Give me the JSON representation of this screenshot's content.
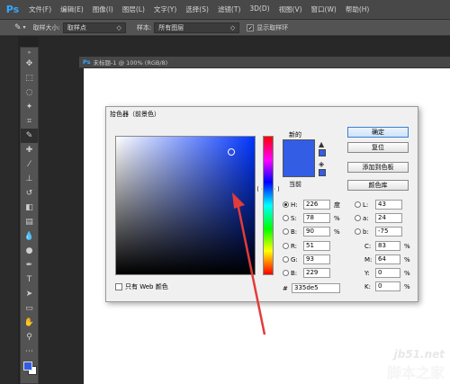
{
  "app": {
    "logo": "Ps"
  },
  "menu": [
    "文件(F)",
    "编辑(E)",
    "图像(I)",
    "图层(L)",
    "文字(Y)",
    "选择(S)",
    "滤镜(T)",
    "3D(D)",
    "视图(V)",
    "窗口(W)",
    "帮助(H)"
  ],
  "options": {
    "sample_size_label": "取样大小:",
    "sample_size_value": "取样点",
    "sample_label": "样本:",
    "sample_value": "所有图层",
    "show_ring_label": "显示取样环"
  },
  "document": {
    "tab_title": "未标题-1 @ 100% (RGB/8)"
  },
  "dialog": {
    "title": "拾色器（前景色）",
    "new_label": "新的",
    "current_label": "当前",
    "ok": "确定",
    "reset": "复位",
    "add_swatch": "添加到色板",
    "color_libraries": "颜色库",
    "web_only": "只有 Web 颜色",
    "hex_label": "#",
    "hex": "335de5",
    "hsb": [
      {
        "label": "H:",
        "value": "226",
        "unit": "度"
      },
      {
        "label": "S:",
        "value": "78",
        "unit": "%"
      },
      {
        "label": "B:",
        "value": "90",
        "unit": "%"
      }
    ],
    "rgb": [
      {
        "label": "R:",
        "value": "51"
      },
      {
        "label": "G:",
        "value": "93"
      },
      {
        "label": "B:",
        "value": "229"
      }
    ],
    "lab": [
      {
        "label": "L:",
        "value": "43"
      },
      {
        "label": "a:",
        "value": "24"
      },
      {
        "label": "b:",
        "value": "-75"
      }
    ],
    "cmyk": [
      {
        "label": "C:",
        "value": "83",
        "unit": "%"
      },
      {
        "label": "M:",
        "value": "64",
        "unit": "%"
      },
      {
        "label": "Y:",
        "value": "0",
        "unit": "%"
      },
      {
        "label": "K:",
        "value": "0",
        "unit": "%"
      }
    ],
    "color": "#335de5"
  },
  "watermark": {
    "line1": "jb51.net",
    "line2": "脚本之家"
  }
}
